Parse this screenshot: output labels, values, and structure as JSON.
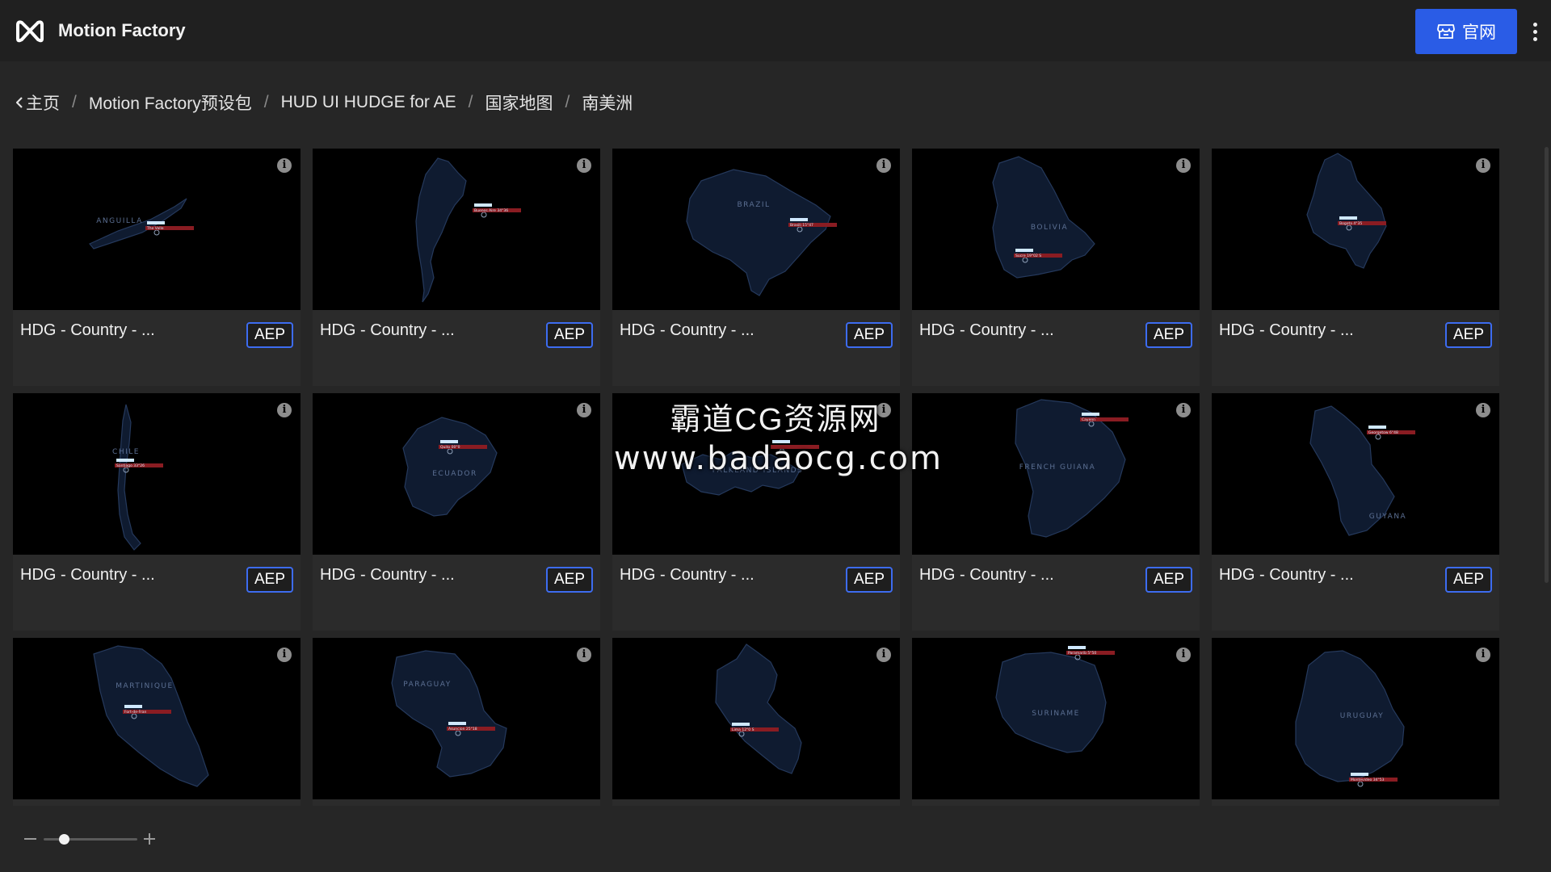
{
  "header": {
    "app_title": "Motion Factory",
    "logo_icon": "motion-factory-logo-icon",
    "site_button_label": "官网",
    "site_button_icon": "store-icon",
    "more_icon": "more-vertical-icon",
    "accent_color": "#2a5ce6"
  },
  "breadcrumb": {
    "items": [
      "主页",
      "Motion Factory预设包",
      "HUD UI HUDGE for AE",
      "国家地图",
      "南美洲"
    ],
    "separator": "/"
  },
  "cards": [
    {
      "title": "HDG - Country - ...",
      "badge": "AEP",
      "map_label": "ANGUILLA",
      "city_label": "The Valle"
    },
    {
      "title": "HDG - Country - ...",
      "badge": "AEP",
      "map_label": "",
      "city_label": "Buenos Aire 34°36"
    },
    {
      "title": "HDG - Country - ...",
      "badge": "AEP",
      "map_label": "BRAZIL",
      "city_label": "Brasili 15°47"
    },
    {
      "title": "HDG - Country - ...",
      "badge": "AEP",
      "map_label": "BOLIVIA",
      "city_label": "Sucre 19°02 S"
    },
    {
      "title": "HDG - Country - ...",
      "badge": "AEP",
      "map_label": "",
      "city_label": "Bogota 4°35"
    },
    {
      "title": "HDG - Country - ...",
      "badge": "AEP",
      "map_label": "CHILE",
      "city_label": "Santiago 33°26"
    },
    {
      "title": "HDG - Country - ...",
      "badge": "AEP",
      "map_label": "ECUADOR",
      "city_label": "Quito 00°0"
    },
    {
      "title": "HDG - Country - ...",
      "badge": "AEP",
      "map_label": "FALKLAND ISLANDS",
      "city_label": ""
    },
    {
      "title": "HDG - Country - ...",
      "badge": "AEP",
      "map_label": "FRENCH GUIANA",
      "city_label": "Cayenn"
    },
    {
      "title": "HDG - Country - ...",
      "badge": "AEP",
      "map_label": "GUYANA",
      "city_label": "Georgetow 6°48"
    },
    {
      "title": "",
      "badge": "",
      "map_label": "MARTINIQUE",
      "city_label": "Fort-de-Fran"
    },
    {
      "title": "",
      "badge": "",
      "map_label": "PARAGUAY",
      "city_label": "Asuncion 25°18"
    },
    {
      "title": "",
      "badge": "",
      "map_label": "",
      "city_label": "Lima 12°0 S"
    },
    {
      "title": "",
      "badge": "",
      "map_label": "SURINAME",
      "city_label": "Paramarib 5°50"
    },
    {
      "title": "",
      "badge": "",
      "map_label": "URUGUAY",
      "city_label": "Montevideo 34°53"
    }
  ],
  "card_info_icon": "info-icon",
  "watermark": {
    "line1": "霸道CG资源网",
    "line2": "www.badaocg.com"
  },
  "zoom": {
    "minus_icon": "minus-icon",
    "plus_icon": "plus-icon",
    "level": 0.2
  }
}
